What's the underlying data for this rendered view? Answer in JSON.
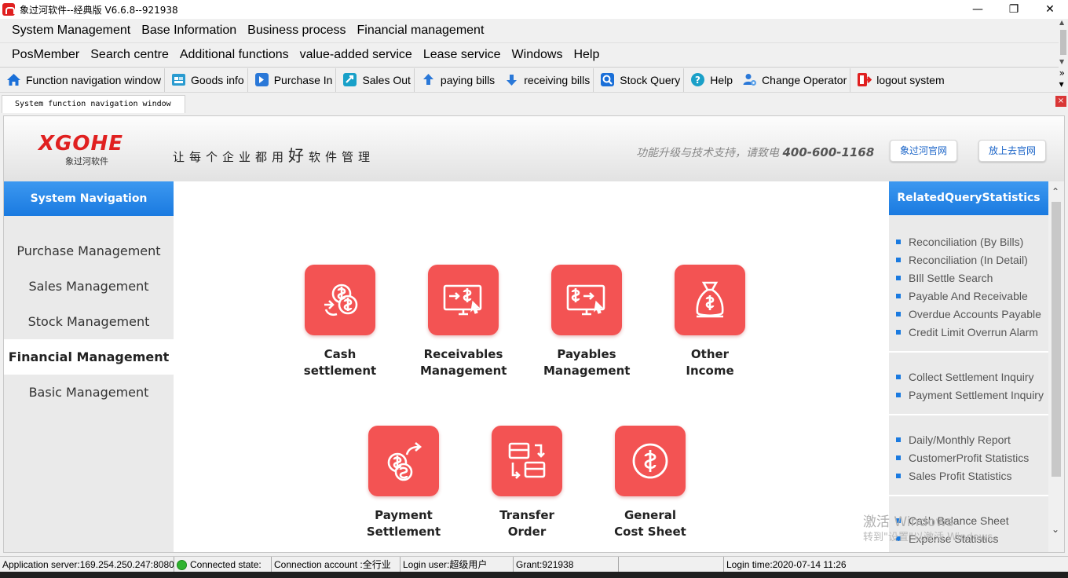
{
  "window": {
    "title": "象过河软件--经典版 V6.6.8--921938"
  },
  "menu_row1": [
    "System Management",
    "Base Information",
    "Business process",
    "Financial management"
  ],
  "menu_row2": [
    "PosMember",
    "Search centre",
    "Additional functions",
    "value-added service",
    "Lease service",
    "Windows",
    "Help"
  ],
  "toolbar": [
    {
      "label": "Function navigation window",
      "icon": "home-icon",
      "color": "#1a6fd8"
    },
    {
      "label": "Goods info",
      "icon": "goods-icon",
      "color": "#2a9bd0"
    },
    {
      "label": "Purchase In",
      "icon": "purchase-in-icon",
      "color": "#2a78d8"
    },
    {
      "label": "Sales Out",
      "icon": "sales-out-icon",
      "color": "#18a0c8"
    },
    {
      "label": "paying bills",
      "icon": "paying-bills-icon",
      "color": "#2a78d8"
    },
    {
      "label": "receiving bills",
      "icon": "receiving-bills-icon",
      "color": "#2a78d8"
    },
    {
      "label": "Stock Query",
      "icon": "stock-query-icon",
      "color": "#1a6fd8"
    },
    {
      "label": "Help",
      "icon": "help-icon",
      "color": "#1aa0c8"
    },
    {
      "label": "Change  Operator",
      "icon": "change-operator-icon",
      "color": "#2a78d8"
    },
    {
      "label": "logout  system",
      "icon": "logout-icon",
      "color": "#e02020"
    }
  ],
  "tab": {
    "label": "System function navigation window",
    "close": "×"
  },
  "banner": {
    "logo": "XGOHE",
    "logo_sub": "象过河软件",
    "slogan_a": "让每个企业都用",
    "slogan_b": "好",
    "slogan_c": "软件管理",
    "support": "功能升级与技术支持，请致电 ",
    "phone": "400-600-1168",
    "btn1": "象过河官网",
    "btn2": "放上去官网"
  },
  "left_nav": {
    "header": "System Navigation",
    "items": [
      "Purchase Management",
      "Sales Management",
      "Stock Management",
      "Financial Management",
      "Basic Management"
    ],
    "active_index": 3
  },
  "tiles": [
    {
      "line1": "Cash",
      "line2": "settlement",
      "icon": "cash-settlement-icon"
    },
    {
      "line1": "Receivables",
      "line2": "Management",
      "icon": "receivables-icon"
    },
    {
      "line1": "Payables",
      "line2": "Management",
      "icon": "payables-icon"
    },
    {
      "line1": "Other",
      "line2": "Income",
      "icon": "money-bag-icon"
    },
    {
      "line1": "Payment",
      "line2": "Settlement",
      "icon": "payment-settlement-icon"
    },
    {
      "line1": "Transfer",
      "line2": "Order",
      "icon": "transfer-order-icon"
    },
    {
      "line1": "General",
      "line2": "Cost Sheet",
      "icon": "cost-sheet-icon"
    }
  ],
  "right_panel": {
    "header": "RelatedQueryStatistics",
    "groups": [
      [
        "Reconciliation (By Bills)",
        "Reconciliation (In Detail)",
        "BIll Settle Search",
        "Payable And Receivable",
        "Overdue Accounts Payable",
        "Credit Limit Overrun Alarm"
      ],
      [
        "Collect Settlement Inquiry",
        "Payment Settlement Inquiry"
      ],
      [
        "Daily/Monthly Report",
        "CustomerProfit Statistics",
        "Sales Profit Statistics"
      ],
      [
        "Cash Balance Sheet",
        "Expense Statistics"
      ]
    ]
  },
  "watermark": {
    "line1": "激活 Windows",
    "line2": "转到\"设置\"以激活 Windows。"
  },
  "status": {
    "server": "Application server:169.254.250.247:8080",
    "connected": "Connected state:",
    "account": "Connection account :全行业",
    "user": "Login user:超级用户",
    "grant": "Grant:921938",
    "empty": "",
    "login_time": "Login time:2020-07-14 11:26"
  }
}
